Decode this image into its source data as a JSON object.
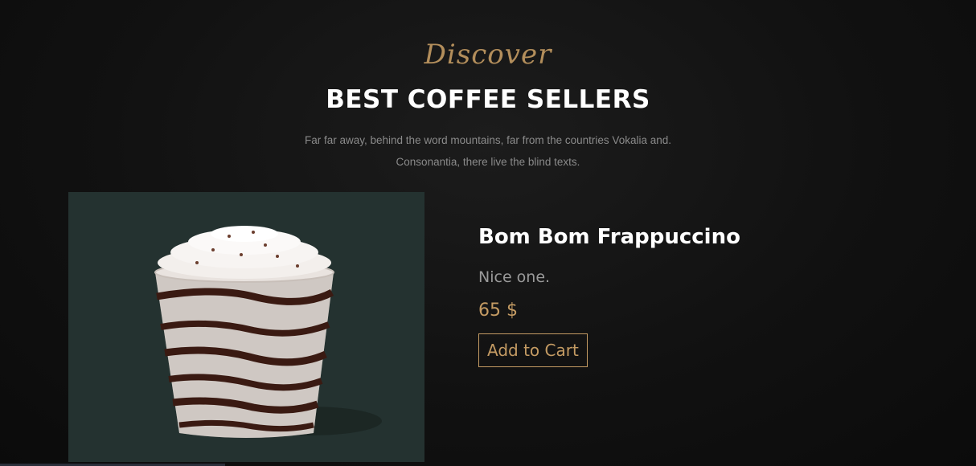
{
  "section": {
    "subheading": "Discover",
    "title": "BEST COFFEE SELLERS",
    "intro": "Far far away, behind the word mountains, far from the countries Vokalia and. Consonantia, there live the blind texts."
  },
  "product": {
    "image_name": "frappuccino-image",
    "name": "Bom Bom Frappuccino",
    "description": "Nice one.",
    "price": "65 $",
    "add_to_cart_label": "Add to Cart"
  },
  "colors": {
    "accent": "#c49b63",
    "background": "#111111",
    "image_bg": "#243230",
    "text_primary": "#ffffff",
    "text_muted": "#9a9a9a"
  }
}
